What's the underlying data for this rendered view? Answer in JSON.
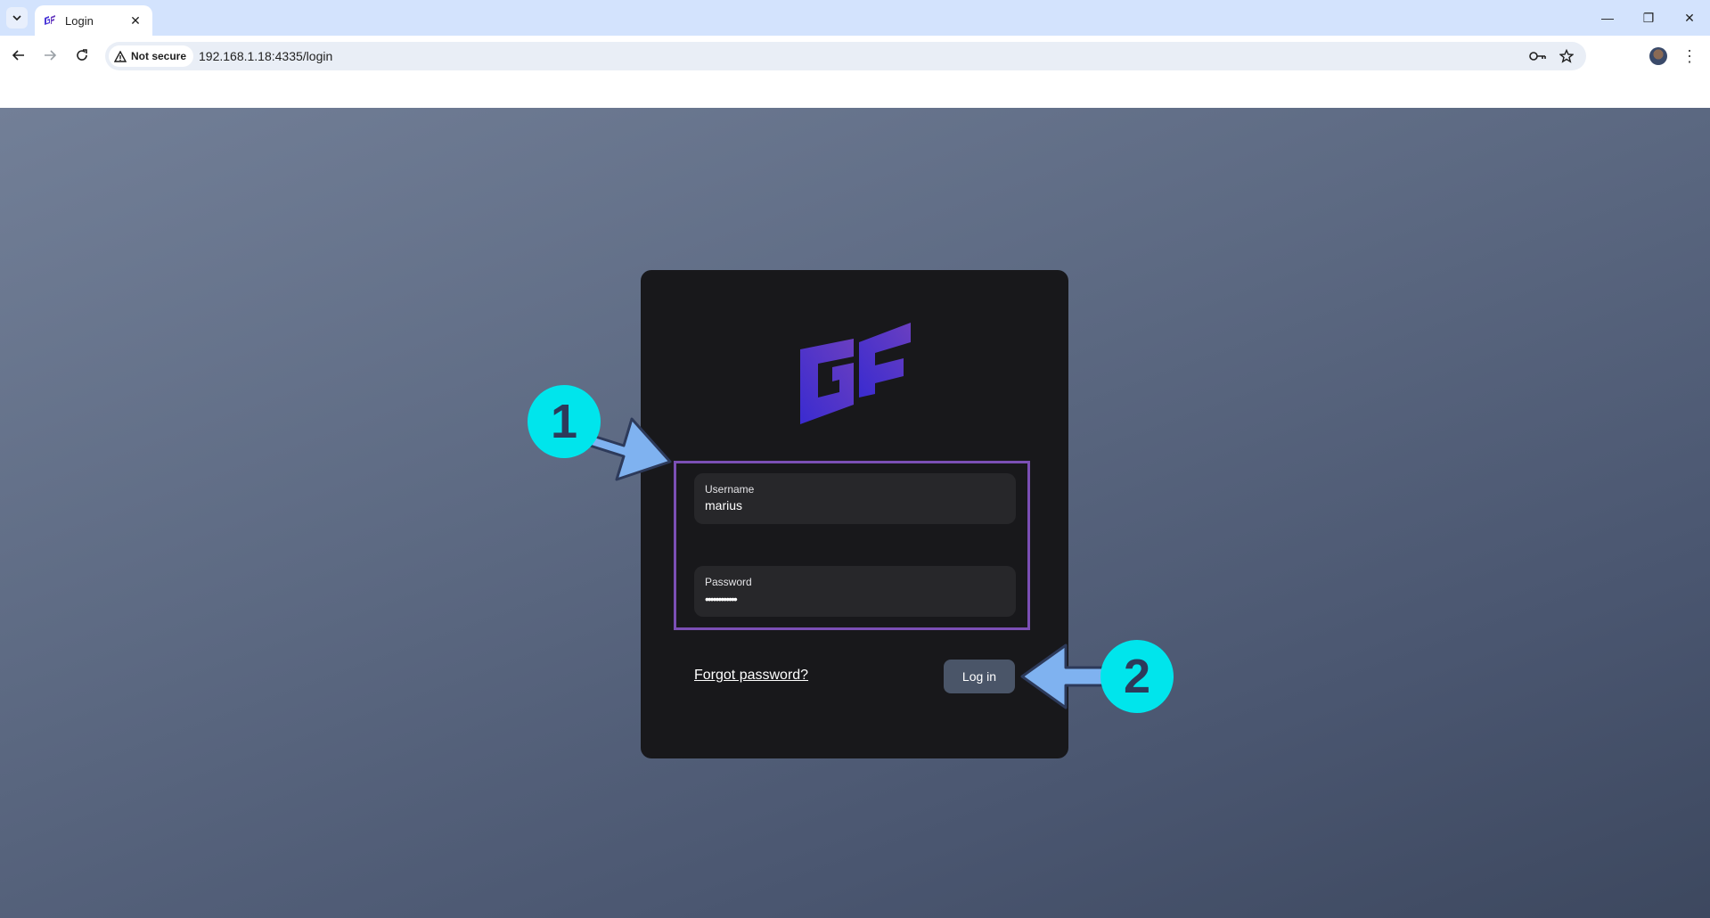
{
  "browser": {
    "tab_title": "Login",
    "tab_close_glyph": "✕",
    "security_label": "Not secure",
    "url": "192.168.1.18:4335/login",
    "window_controls": {
      "minimize": "—",
      "restore": "❐",
      "close": "✕"
    },
    "icons": [
      "tab-search-icon",
      "back-icon",
      "forward-icon",
      "reload-icon",
      "warning-icon",
      "password-key-icon",
      "bookmark-star-icon",
      "profile-avatar",
      "menu-icon"
    ]
  },
  "login": {
    "username_label": "Username",
    "username_value": "marius",
    "password_label": "Password",
    "password_mask": "••••••••••••",
    "forgot_link": "Forgot password?",
    "submit_label": "Log in"
  },
  "annotations": {
    "step1": "1",
    "step2": "2",
    "badge_color": "#00e5ec",
    "arrow_color": "#7fb2f0",
    "highlight_color": "#7b4fb5"
  },
  "colors": {
    "card": "#18181b",
    "field": "#27272a",
    "button": "#4a5568",
    "logo_from": "#3a2bd0",
    "logo_to": "#6a3fc0"
  }
}
